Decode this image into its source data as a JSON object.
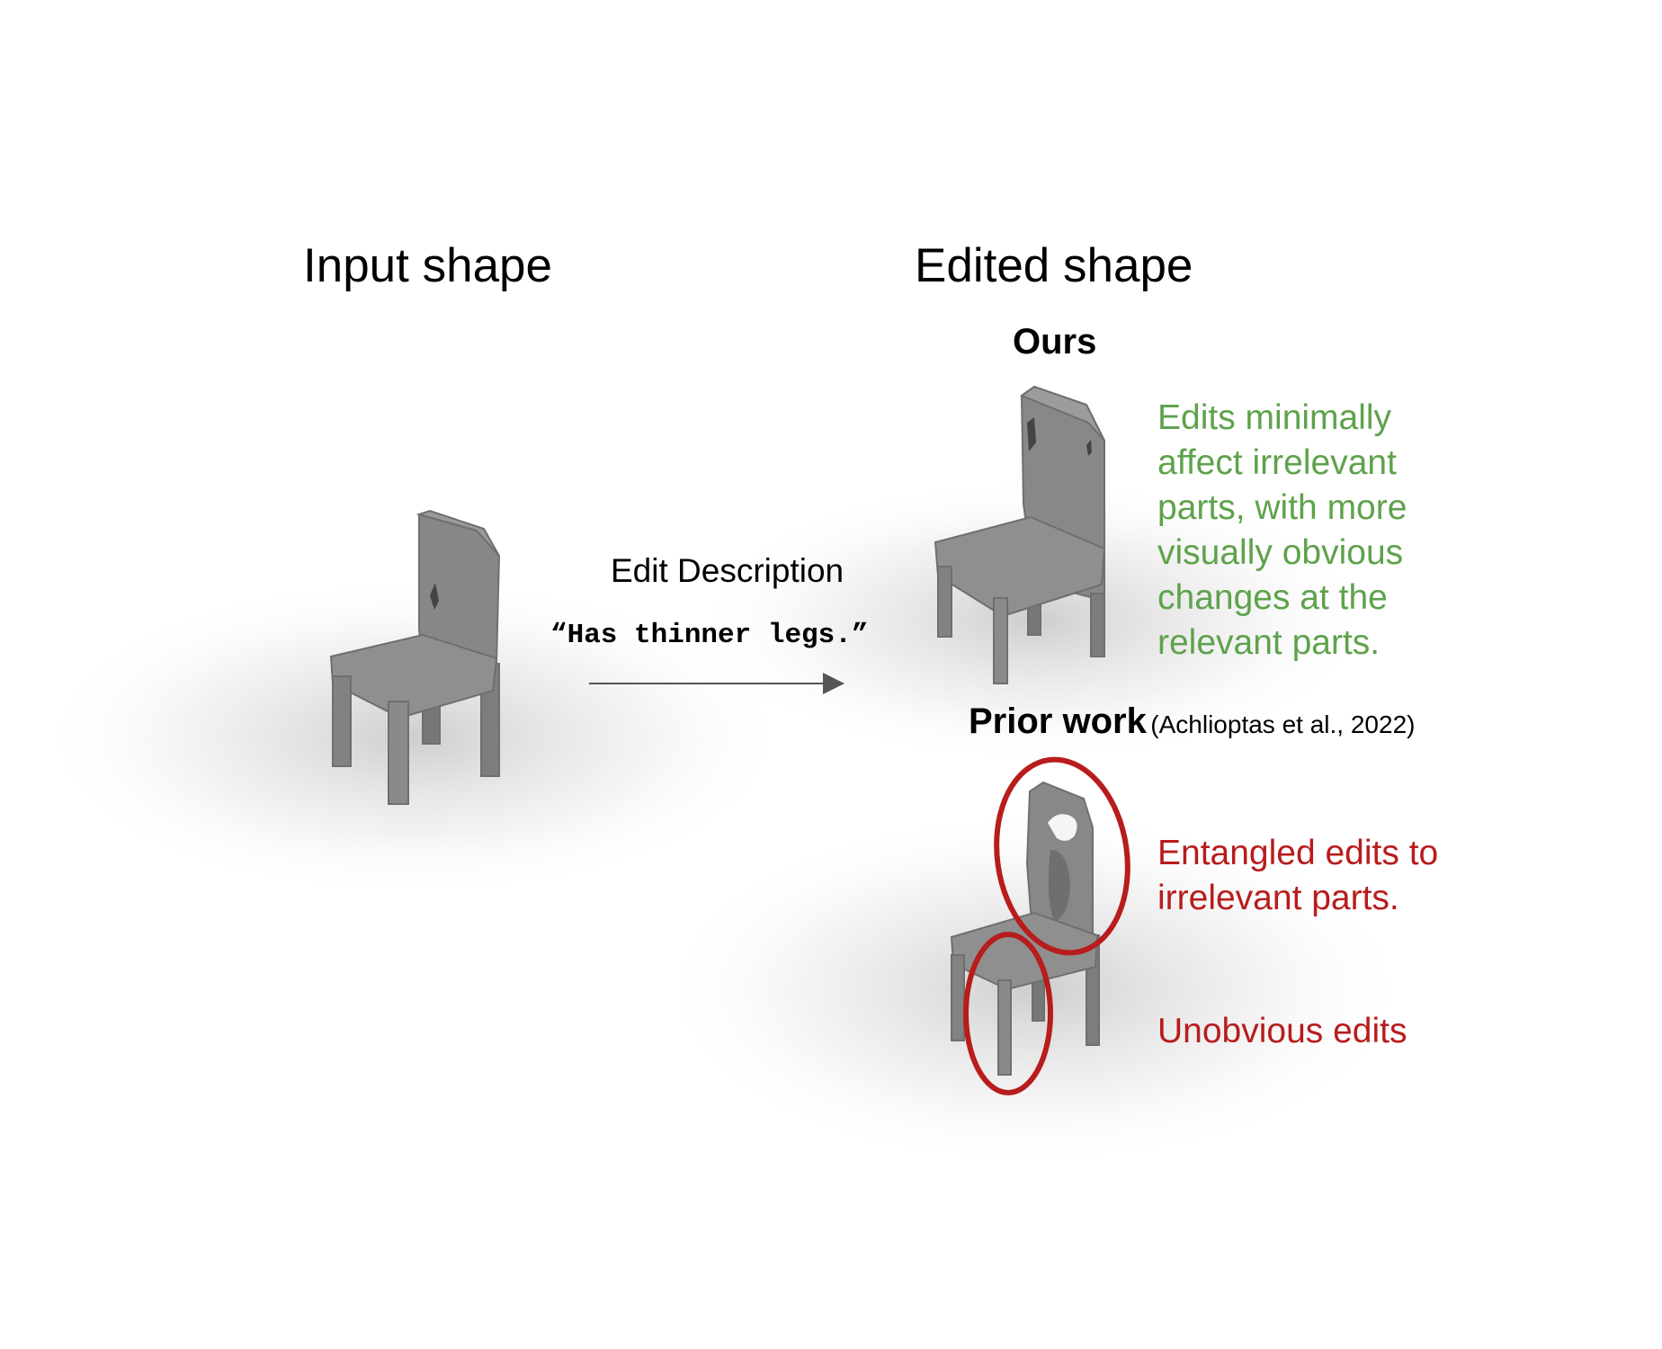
{
  "headings": {
    "input_shape": "Input shape",
    "edited_shape": "Edited shape"
  },
  "ours": {
    "label": "Ours",
    "note_lines": [
      "Edits minimally",
      "affect irrelevant",
      "parts, with more",
      "visually obvious",
      "changes at the",
      "relevant parts."
    ]
  },
  "prior_work": {
    "label": "Prior work",
    "citation": "(Achlioptas et al., 2022)",
    "entangled_lines": [
      "Entangled edits to",
      "irrelevant parts."
    ],
    "unobvious": "Unobvious edits"
  },
  "edit": {
    "label": "Edit Description",
    "text": "“Has thinner legs.”"
  },
  "colors": {
    "positive": "#5ea24b",
    "negative": "#b81c1c",
    "chair": "#8a8a8a",
    "arrow": "#555555"
  }
}
